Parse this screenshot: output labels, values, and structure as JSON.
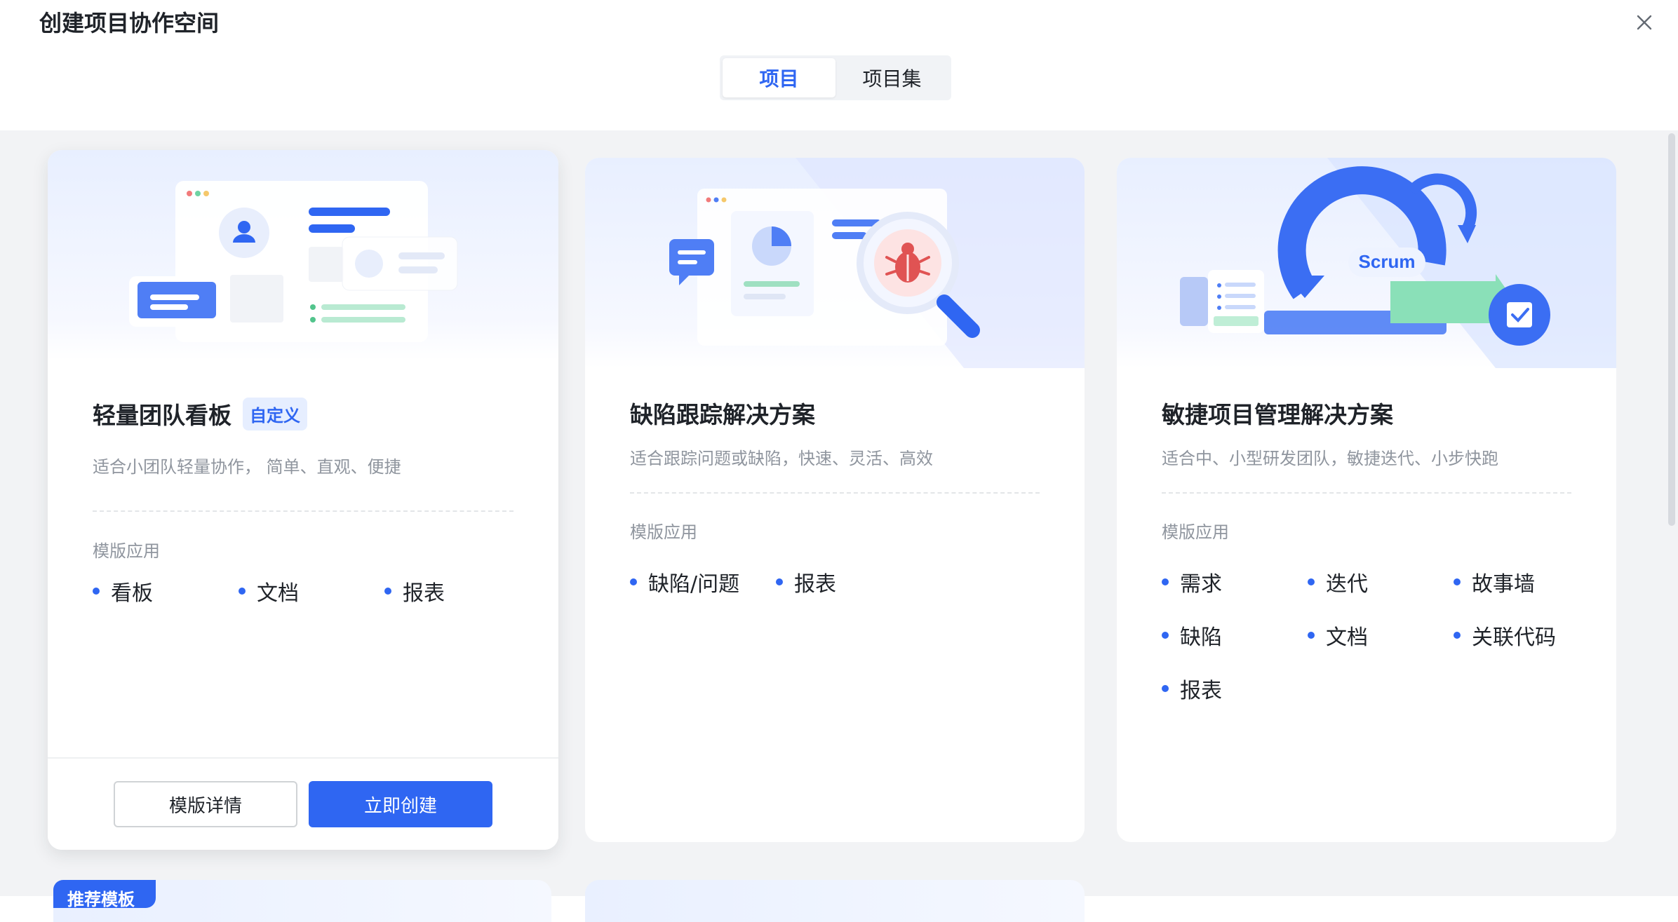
{
  "dialog": {
    "title": "创建项目协作空间",
    "tabs": [
      {
        "label": "项目",
        "active": true
      },
      {
        "label": "项目集",
        "active": false
      }
    ]
  },
  "cards": [
    {
      "title": "轻量团队看板",
      "tag": "自定义",
      "description": "适合小团队轻量协作， 简单、直观、便捷",
      "section_label": "模版应用",
      "apps": [
        "看板",
        "文档",
        "报表"
      ],
      "buttons": {
        "detail": "模版详情",
        "create": "立即创建"
      }
    },
    {
      "title": "缺陷跟踪解决方案",
      "description": "适合跟踪问题或缺陷，快速、灵活、高效",
      "section_label": "模版应用",
      "apps": [
        "缺陷/问题",
        "报表"
      ]
    },
    {
      "title": "敏捷项目管理解决方案",
      "description": "适合中、小型研发团队，敏捷迭代、小步快跑",
      "section_label": "模版应用",
      "apps": [
        "需求",
        "迭代",
        "故事墙",
        "缺陷",
        "文档",
        "关联代码",
        "报表"
      ],
      "hero_label": "Scrum"
    }
  ],
  "recommend_badge": "推荐模板",
  "colors": {
    "primary": "#2f66f2",
    "content_bg": "#f2f3f5",
    "muted_text": "#8f959e"
  }
}
